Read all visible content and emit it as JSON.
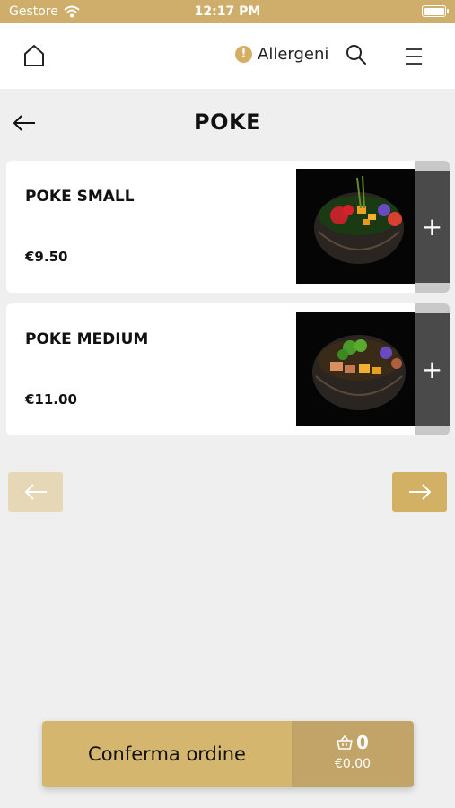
{
  "status_bar": {
    "carrier": "Gestore",
    "time": "12:17 PM",
    "wifi_icon": "wifi-icon",
    "battery_icon": "battery-icon"
  },
  "nav": {
    "home_icon": "home-icon",
    "allergen_badge": "!",
    "allergen_label": "Allergeni",
    "search_icon": "search-icon",
    "menu_icon": "hamburger-menu-icon"
  },
  "page": {
    "back_icon": "arrow-left-icon",
    "title": "POKE"
  },
  "products": [
    {
      "name": "POKE SMALL",
      "price": "€9.50",
      "add_label": "+"
    },
    {
      "name": "POKE MEDIUM",
      "price": "€11.00",
      "add_label": "+"
    }
  ],
  "pager": {
    "prev_icon": "arrow-left-icon",
    "next_icon": "arrow-right-icon"
  },
  "order": {
    "confirm_label": "Conferma ordine",
    "cart_icon": "basket-icon",
    "cart_count": "0",
    "cart_total": "€0.00"
  },
  "colors": {
    "accent_gold": "#d4b66e",
    "accent_dark_gold": "#c3a468",
    "status_bar": "#cfae6b",
    "add_button": "#4a4a4a"
  }
}
